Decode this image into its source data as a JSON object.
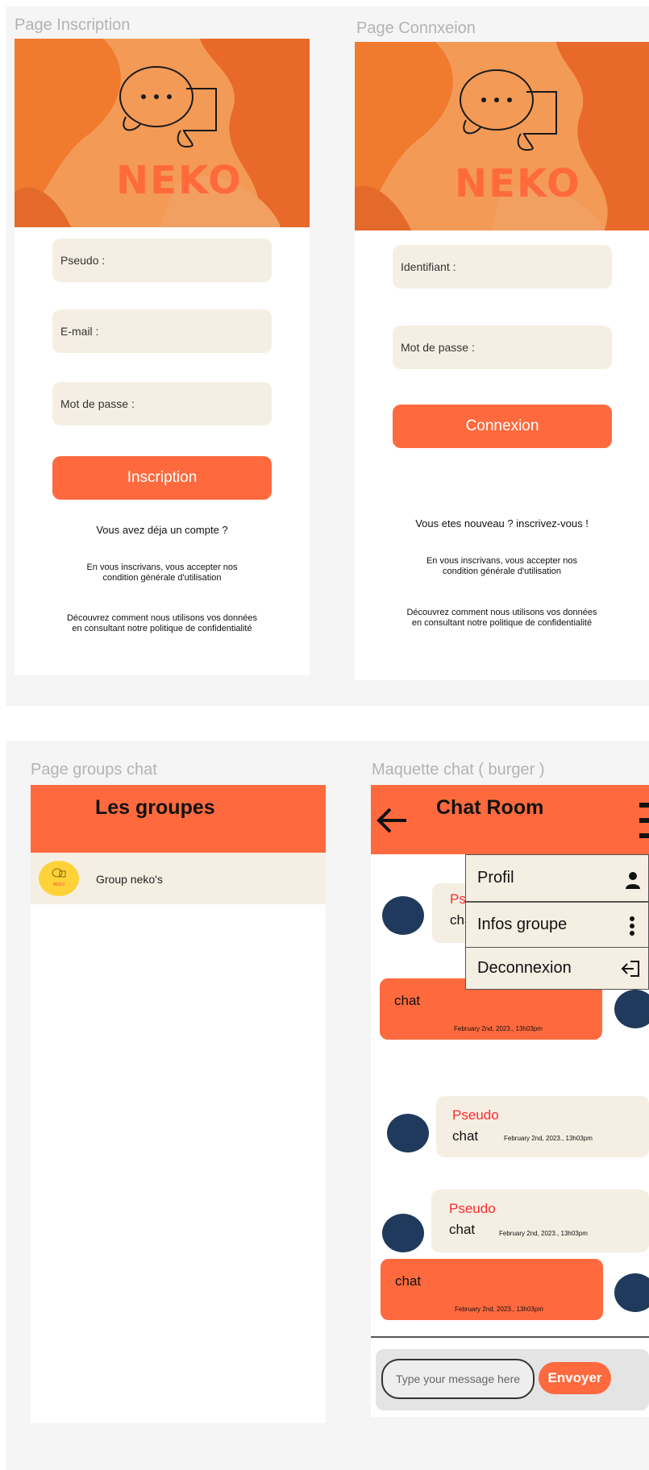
{
  "frames": {
    "signup_label": "Page Inscription",
    "login_label": "Page Connxeion",
    "groups_label": "Page groups  chat",
    "chat_label": "Maquette chat ( burger )"
  },
  "brand": {
    "name": "NEKO",
    "chat_glyph": "..."
  },
  "signup": {
    "pseudo_placeholder": "Pseudo :",
    "email_placeholder": "E-mail :",
    "password_placeholder": "Mot de passe :",
    "submit_label": "Inscription",
    "have_account": "Vous avez déja un compte ?",
    "terms_line1": "En vous inscrivans, vous accepter nos",
    "terms_line2": "condition générale d'utilisation",
    "privacy_line1": "Découvrez comment nous utilisons vos données",
    "privacy_line2": "en consultant notre politique de confidentialité"
  },
  "login": {
    "id_placeholder": "Identifiant :",
    "password_placeholder": "Mot de passe :",
    "submit_label": "Connexion",
    "new_user": "Vous etes nouveau ? inscrivez-vous !",
    "terms_line1": "En vous inscrivans, vous accepter nos",
    "terms_line2": "condition générale d'utilisation",
    "privacy_line1": "Découvrez comment nous utilisons vos données",
    "privacy_line2": "en consultant notre politique de confidentialité"
  },
  "groups": {
    "title": "Les groupes",
    "items": [
      {
        "name": "Group neko's",
        "badge": "NEKO"
      }
    ]
  },
  "chat": {
    "title": "Chat Room",
    "menu": {
      "profile": "Profil",
      "group_info": "Infos groupe",
      "logout": "Deconnexion"
    },
    "messages": [
      {
        "pseudo": "Pseudo",
        "text": "chat"
      },
      {
        "text": "chat",
        "timestamp": "February 2nd, 2023., 13h03pm"
      },
      {
        "pseudo": "Pseudo",
        "text": "chat",
        "timestamp": "February 2nd, 2023., 13h03pm"
      },
      {
        "pseudo": "Pseudo",
        "text": "chat",
        "timestamp": "February 2nd, 2023., 13h03pm"
      },
      {
        "text": "chat",
        "timestamp": "February 2nd, 2023., 13h03pm"
      }
    ],
    "input_placeholder": "Type your message here",
    "send_label": "Envoyer"
  },
  "colors": {
    "accent": "#fe6a3e",
    "field": "#f5efe3",
    "avatar": "#1f3a5c",
    "pseudo": "#ff2a2a"
  }
}
